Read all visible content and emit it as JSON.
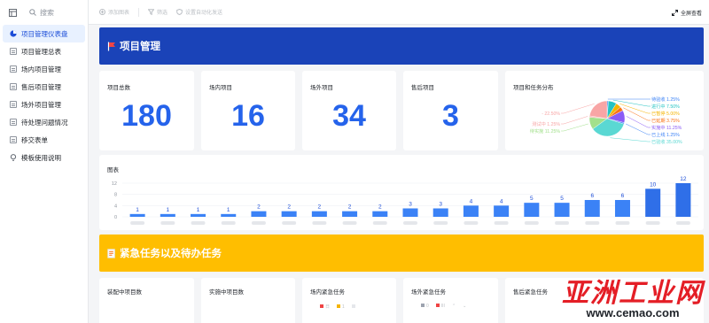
{
  "sidebar": {
    "search_placeholder": "搜索",
    "items": [
      {
        "label": "项目管理仪表盘",
        "active": true
      },
      {
        "label": "项目管理总表"
      },
      {
        "label": "场内项目管理"
      },
      {
        "label": "售后项目管理"
      },
      {
        "label": "场外项目管理"
      },
      {
        "label": "待处理问题情况"
      },
      {
        "label": "移交表单"
      },
      {
        "label": "模板使用说明"
      }
    ]
  },
  "toolbar": {
    "add_chart": "添加图表",
    "filter": "筛选",
    "auto_send": "设置自动化发送",
    "fullscreen": "全屏查看"
  },
  "banner1": {
    "title": "项目管理"
  },
  "stats": [
    {
      "label": "项目总数",
      "value": "180"
    },
    {
      "label": "场内项目",
      "value": "16"
    },
    {
      "label": "场外项目",
      "value": "34"
    },
    {
      "label": "售后项目",
      "value": "3"
    }
  ],
  "pie_card": {
    "title": "项目和任务分布"
  },
  "bar_card": {
    "title": "图表"
  },
  "chart_data": [
    {
      "type": "pie",
      "slices": [
        {
          "label": "待验收",
          "pct": "1.25%",
          "value": 1.25,
          "color": "#3b82f6"
        },
        {
          "label": "进行中",
          "pct": "7.50%",
          "value": 7.5,
          "color": "#22c3c3"
        },
        {
          "label": "已暂停",
          "pct": "5.00%",
          "value": 5.0,
          "color": "#f5b400"
        },
        {
          "label": "已延期",
          "pct": "3.75%",
          "value": 3.75,
          "color": "#f97316"
        },
        {
          "label": "实施中",
          "pct": "11.25%",
          "value": 11.25,
          "color": "#8b5cf6"
        },
        {
          "label": "已上线",
          "pct": "1.25%",
          "value": 1.25,
          "color": "#3b82f6"
        },
        {
          "label": "已验收",
          "pct": "35.00%",
          "value": 35.0,
          "color": "#5ad8d3"
        },
        {
          "label": "待实施",
          "pct": "11.25%",
          "value": 11.25,
          "color": "#a3e08c"
        },
        {
          "label": "测试中",
          "pct": "1.25%",
          "value": 1.25,
          "color": "#f8a5a5"
        },
        {
          "label": "-",
          "pct": "22.50%",
          "value": 22.5,
          "color": "#f8a5a5"
        }
      ]
    },
    {
      "type": "bar",
      "yticks": [
        "12",
        "8",
        "4",
        "0"
      ],
      "ylim": [
        0,
        12
      ],
      "values": [
        1,
        1,
        1,
        1,
        2,
        2,
        2,
        2,
        2,
        3,
        3,
        4,
        4,
        5,
        5,
        6,
        6,
        10,
        12
      ]
    }
  ],
  "banner2": {
    "title": "紧急任务以及待办任务"
  },
  "small_cards": [
    {
      "label": "装配中项目数"
    },
    {
      "label": "实施中项目数"
    },
    {
      "label": "场内紧急任务",
      "legend": [
        "日",
        "1"
      ]
    },
    {
      "label": "场外紧急任务",
      "legend": [
        "0",
        "III"
      ]
    },
    {
      "label": "售后紧急任务"
    }
  ],
  "watermark": {
    "line1": "亚洲工业网",
    "line2": "www.cemao.com"
  },
  "colors": {
    "accent": "#2563eb",
    "banner_blue": "#1a43b8",
    "banner_yellow": "#ffbe00"
  }
}
